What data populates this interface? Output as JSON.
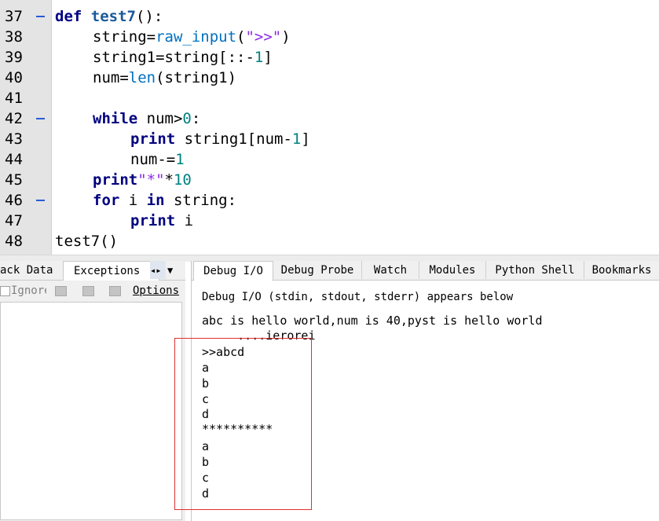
{
  "editor": {
    "lines": [
      {
        "n": "37",
        "fold": true
      },
      {
        "n": "38",
        "fold": false
      },
      {
        "n": "39",
        "fold": false
      },
      {
        "n": "40",
        "fold": false
      },
      {
        "n": "41",
        "fold": false
      },
      {
        "n": "42",
        "fold": true
      },
      {
        "n": "43",
        "fold": false
      },
      {
        "n": "44",
        "fold": false
      },
      {
        "n": "45",
        "fold": false
      },
      {
        "n": "46",
        "fold": true
      },
      {
        "n": "47",
        "fold": false
      },
      {
        "n": "48",
        "fold": false
      }
    ],
    "code": {
      "l37_kw": "def",
      "l37_fn": "test7",
      "l37_rest": "():",
      "l38_a": "string=",
      "l38_bi": "raw_input",
      "l38_p1": "(",
      "l38_st": "\">>\"",
      "l38_p2": ")",
      "l39_a": "string1=string[::-",
      "l39_nm": "1",
      "l39_b": "]",
      "l40_a": "num=",
      "l40_bi": "len",
      "l40_b": "(string1)",
      "l42_kw": "while",
      "l42_a": " num>",
      "l42_nm": "0",
      "l42_b": ":",
      "l43_kw": "print",
      "l43_a": " string1[num-",
      "l43_nm": "1",
      "l43_b": "]",
      "l44_a": "num-=",
      "l44_nm": "1",
      "l45_kw": "print",
      "l45_st": "\"*\"",
      "l45_a": "*",
      "l45_nm": "10",
      "l46_kw1": "for",
      "l46_a": " i ",
      "l46_kw2": "in",
      "l46_b": " string:",
      "l47_kw": "print",
      "l47_a": " i",
      "l48_a": "test7()"
    }
  },
  "left_panel": {
    "tabs": [
      "ack Data",
      "Exceptions"
    ],
    "tab_arrows": "◂▸",
    "dropdown_glyph": "▼",
    "ignore_label": "Ignore",
    "options_label": "Options"
  },
  "right_panel": {
    "tabs": [
      "Debug I/O",
      "Debug Probe",
      "Watch",
      "Modules",
      "Python Shell",
      "Bookmarks"
    ],
    "subtitle": "Debug I/O (stdin, stdout, stderr) appears below",
    "output_lines": [
      "abc is hello world,num is 40,pyst is hello world",
      "     ....ierorei",
      ">>abcd",
      "a",
      "b",
      "c",
      "d",
      "**********",
      "a",
      "b",
      "c",
      "d"
    ]
  },
  "colors": {
    "keyword": "#000080",
    "builtin": "#0070c0",
    "string": "#8a2be2",
    "number": "#008080",
    "highlight_box": "#e03030"
  }
}
